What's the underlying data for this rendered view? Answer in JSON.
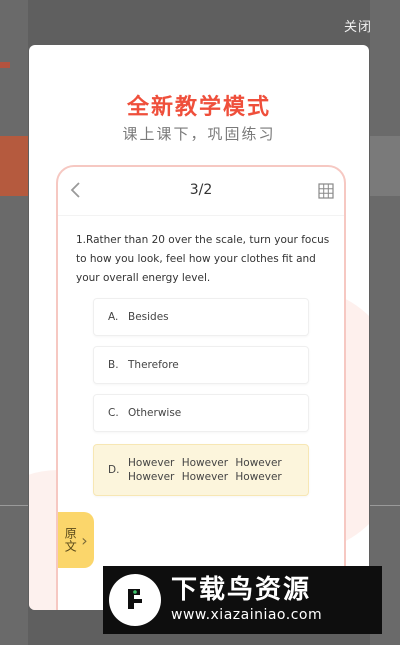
{
  "close_label": "关闭",
  "promo": {
    "title": "全新教学模式",
    "subtitle": "课上课下，巩固练习"
  },
  "phone": {
    "page_counter": "3/2",
    "question": "1.Rather than 20 over the scale, turn your focus to how you look, feel how your clothes fit and your overall energy level.",
    "options": [
      {
        "letter": "A.",
        "text": "Besides",
        "selected": false
      },
      {
        "letter": "B.",
        "text": "Therefore",
        "selected": false
      },
      {
        "letter": "C.",
        "text": "Otherwise",
        "selected": false
      },
      {
        "letter": "D.",
        "text": "However However However However However However",
        "selected": true
      }
    ],
    "original_text_tab": "原文"
  },
  "watermark": {
    "name": "下载鸟资源",
    "url": "www.xiazainiao.com"
  },
  "colors": {
    "accent": "#ef4f3b",
    "selected_bg": "#fcf5dc",
    "tab_yellow": "#fbd66b"
  }
}
